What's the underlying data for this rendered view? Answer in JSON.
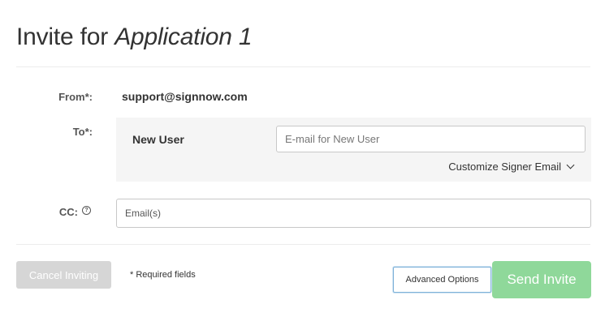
{
  "title": {
    "prefix": "Invite for ",
    "document_name": "Application 1"
  },
  "from": {
    "label": "From*:",
    "value": "support@signnow.com"
  },
  "to": {
    "label": "To*:",
    "signer_name": "New User",
    "email_placeholder": "E-mail for New User",
    "customize_label": "Customize Signer Email"
  },
  "cc": {
    "label": "CC:",
    "help_glyph": "?",
    "placeholder": "Email(s)"
  },
  "footer": {
    "cancel_label": "Cancel Inviting",
    "required_note": "* Required fields",
    "advanced_label": "Advanced Options",
    "send_label": "Send Invite"
  },
  "colors": {
    "send_button": "#8fd89a",
    "cancel_button": "#d6d6d6",
    "signer_box_bg": "#f5f5f5"
  }
}
